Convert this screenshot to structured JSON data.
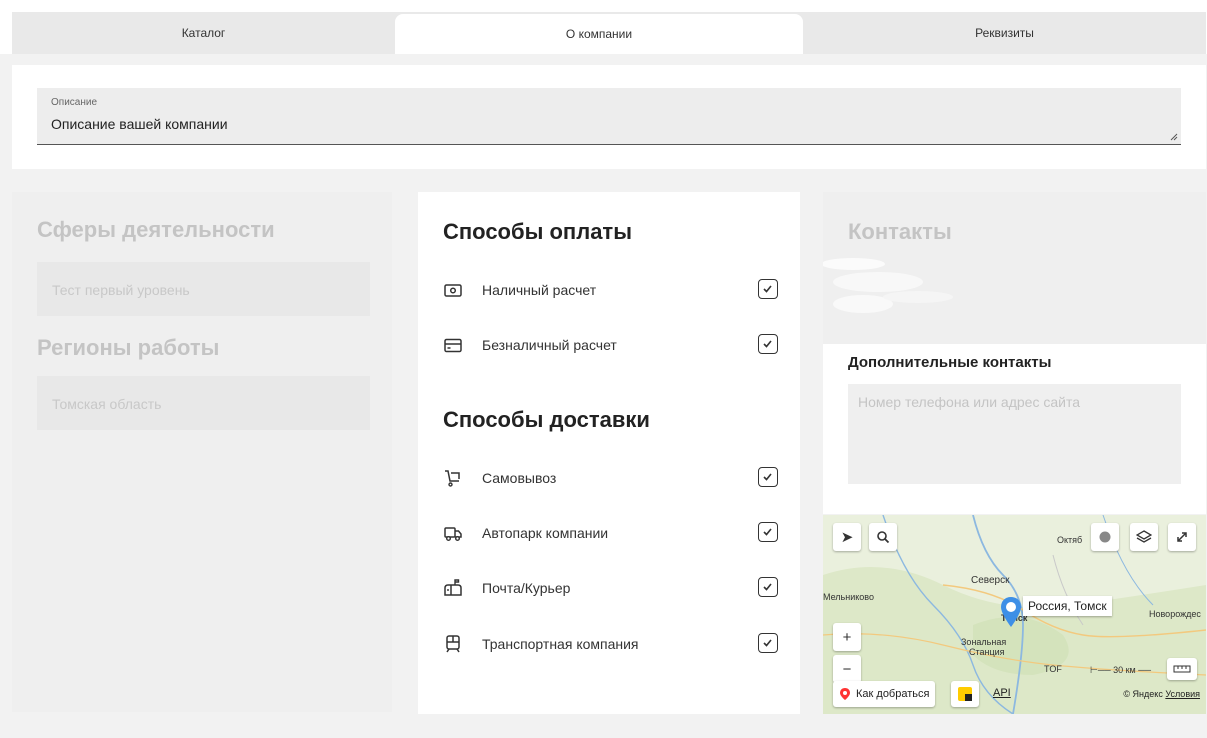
{
  "tabs": [
    {
      "label": "Каталог"
    },
    {
      "label": "О компании",
      "active": true
    },
    {
      "label": "Реквизиты"
    }
  ],
  "description": {
    "label": "Описание",
    "value": "Описание вашей компании"
  },
  "activity": {
    "title": "Сферы деятельности",
    "value": "Тест первый уровень"
  },
  "regions": {
    "title": "Регионы работы",
    "value": "Томская область"
  },
  "payment": {
    "title": "Способы оплаты",
    "options": [
      {
        "label": "Наличный расчет",
        "icon": "cash-icon",
        "checked": true
      },
      {
        "label": "Безналичный расчет",
        "icon": "card-icon",
        "checked": true
      }
    ]
  },
  "delivery": {
    "title": "Способы доставки",
    "options": [
      {
        "label": "Самовывоз",
        "icon": "cart-icon",
        "checked": true
      },
      {
        "label": "Автопарк компании",
        "icon": "truck-icon",
        "checked": true
      },
      {
        "label": "Почта/Курьер",
        "icon": "mailbox-icon",
        "checked": true
      },
      {
        "label": "Транспортная компания",
        "icon": "train-icon",
        "checked": true
      }
    ]
  },
  "contacts": {
    "title": "Контакты",
    "extra_title": "Дополнительные контакты",
    "extra_placeholder": "Номер телефона или адрес сайта"
  },
  "map": {
    "pin_label": "Россия, Томск",
    "route_label": "Как добраться",
    "api_label": "API",
    "copyright": "© Яндекс",
    "terms": "Условия",
    "scale": "30 км",
    "places": {
      "oktyab": "Октяб",
      "seversk": "Северск",
      "melnikovo": "Мельниково",
      "tomsk": "Томск",
      "novorozhdes": "Новорождес",
      "zonalnaya": "Зональная",
      "stantsiya": "Станция",
      "tof": "TOF"
    }
  },
  "colors": {
    "accent": "#3d8fe6",
    "muted_text": "#c4c4c4",
    "panel_bg": "#efefef"
  }
}
